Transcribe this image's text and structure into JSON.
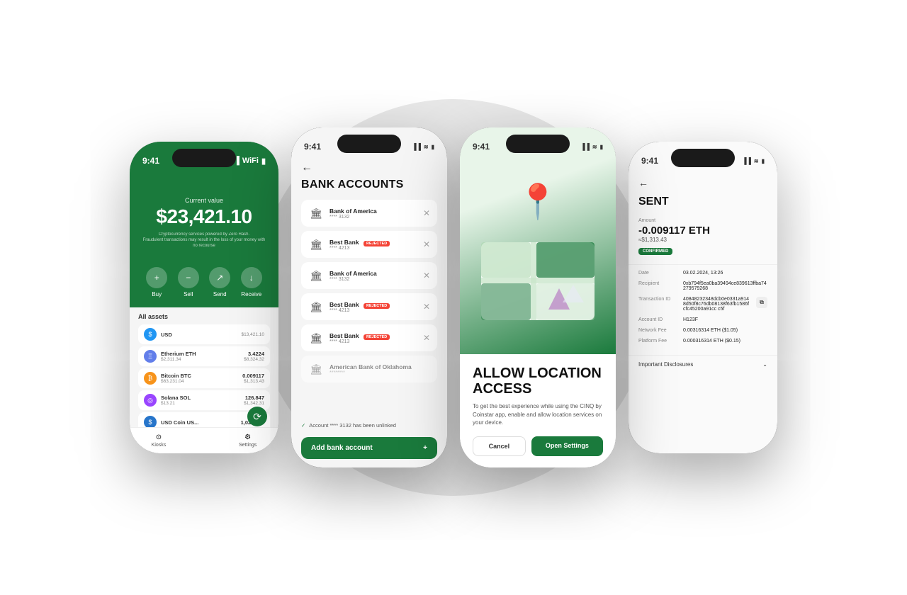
{
  "scene": {
    "background": "#ffffff"
  },
  "phone1": {
    "status_time": "9:41",
    "header": {
      "current_value_label": "Current value",
      "balance": "$23,421.10",
      "disclaimer_line1": "Cryptocurrency services powered by Zero Hash.",
      "disclaimer_line2": "Fraudulent transactions may result in the loss of your money with no recourse"
    },
    "actions": [
      {
        "label": "Buy",
        "icon": "+"
      },
      {
        "label": "Sell",
        "icon": "−"
      },
      {
        "label": "Send",
        "icon": "↗"
      },
      {
        "label": "Receive",
        "icon": "↓"
      }
    ],
    "assets_title": "All assets",
    "assets": [
      {
        "name": "USD",
        "ticker": "",
        "qty": "",
        "value": "$13,421.10",
        "icon_type": "usd",
        "icon": "$"
      },
      {
        "name": "Etherium ETH",
        "ticker": "",
        "qty": "3.4224",
        "value": "$8,324.32",
        "sub": "$2,311.34",
        "icon_type": "eth",
        "icon": "Ξ"
      },
      {
        "name": "Bitcoin BTC",
        "ticker": "",
        "qty": "0.009117",
        "value": "$1,313.43",
        "sub": "$63,231.04",
        "icon_type": "btc",
        "icon": "₿"
      },
      {
        "name": "Solana SOL",
        "ticker": "",
        "qty": "126.847",
        "value": "$1,342.31",
        "sub": "$13.21",
        "icon_type": "sol",
        "icon": "◎"
      },
      {
        "name": "USD Coin US...",
        "ticker": "",
        "qty": "1,026.313",
        "value": "",
        "sub": "",
        "icon_type": "usdc",
        "icon": "$"
      }
    ],
    "bottom_nav": [
      {
        "label": "Kiosks"
      },
      {
        "label": "Settings"
      }
    ]
  },
  "phone2": {
    "status_time": "9:41",
    "back_arrow": "←",
    "title": "BANK ACCOUNTS",
    "banks": [
      {
        "name": "Bank of America",
        "number": "**** 3132",
        "rejected": false,
        "dimmed": false
      },
      {
        "name": "Best Bank",
        "number": "**** 4213",
        "rejected": true,
        "dimmed": false
      },
      {
        "name": "Bank of America",
        "number": "**** 3132",
        "rejected": false,
        "dimmed": false
      },
      {
        "name": "Best Bank",
        "number": "**** 4213",
        "rejected": true,
        "dimmed": false
      },
      {
        "name": "Best Bank",
        "number": "**** 4213",
        "rejected": true,
        "dimmed": false
      },
      {
        "name": "American Bank of Oklahoma",
        "number": "********",
        "rejected": false,
        "dimmed": true
      }
    ],
    "notification": "Account **** 3132 has been unlinked",
    "add_button_label": "Add bank account",
    "rejected_label": "REJECTED"
  },
  "phone3": {
    "status_time": "9:41",
    "title": "ALLOW LOCATION ACCESS",
    "description": "To get the best experience while using the CINQ by Coinstar app, enable and allow location services on your device.",
    "cancel_label": "Cancel",
    "settings_label": "Open Settings"
  },
  "phone4": {
    "status_time": "9:41",
    "back_arrow": "←",
    "title": "SENT",
    "amount_label": "Amount",
    "amount_value": "-0.009117 ETH",
    "amount_fiat": "≈$1,313.43",
    "confirmed_badge": "CONFIRMED",
    "details": [
      {
        "key": "Date",
        "value": "03.02.2024, 13:26",
        "copy": false
      },
      {
        "key": "Recipient",
        "value": "0xb794f5ea0ba39494ce839613ffba74279579268",
        "copy": false
      },
      {
        "key": "Transaction ID",
        "value": "40848232348dcb0e0331a9148d50f8c76db08138f63fb1586fcfc45200a91cc c5f",
        "copy": true
      },
      {
        "key": "Account ID",
        "value": "H123F",
        "copy": false
      },
      {
        "key": "Network Fee",
        "value": "0.00316314 ETH ($1.05)",
        "copy": false
      },
      {
        "key": "Platform Fee",
        "value": "0.000316314 ETH ($0.15)",
        "copy": false
      }
    ],
    "disclosures_label": "Important Disclosures"
  }
}
